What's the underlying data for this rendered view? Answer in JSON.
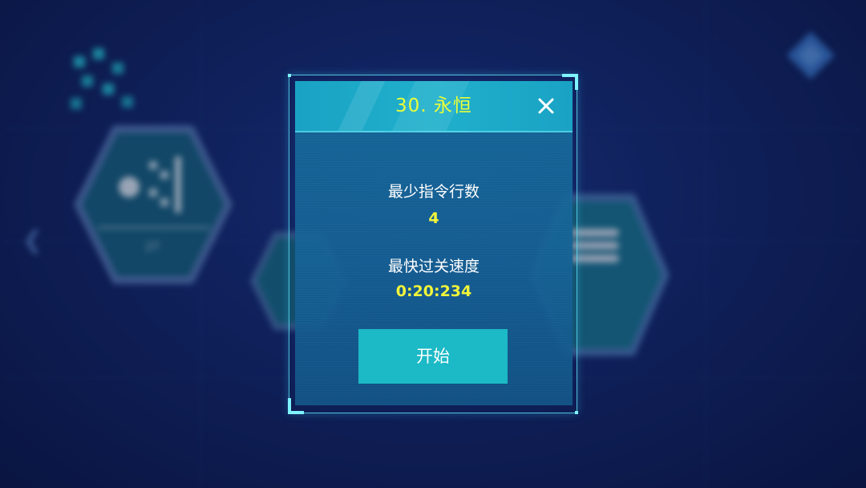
{
  "dialog": {
    "title": "30. 永恒",
    "close_icon": "close-icon",
    "stats": [
      {
        "label": "最少指令行数",
        "value": "4"
      },
      {
        "label": "最快过关速度",
        "value": "0:20:234"
      }
    ],
    "start_label": "开始"
  },
  "background": {
    "left_hex_label": "27"
  },
  "colors": {
    "title": "#e9ff3a",
    "value": "#f2f53a",
    "button": "#1cb9c6",
    "frame": "#7ff3ff"
  }
}
